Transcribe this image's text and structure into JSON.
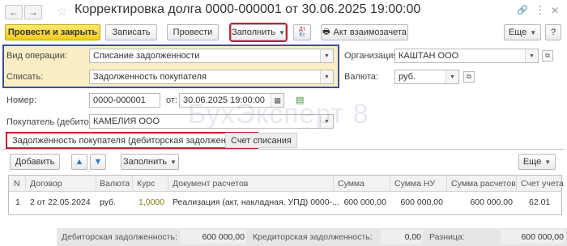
{
  "window": {
    "title": "Корректировка долга 0000-000001 от 30.06.2025 19:00:00",
    "back_glyph": "←",
    "forward_glyph": "→",
    "star_glyph": "☆",
    "link_glyph": "🔗",
    "more_glyph": "⋮",
    "close_glyph": "✕"
  },
  "toolbar": {
    "post_close": "Провести и закрыть",
    "save": "Записать",
    "post": "Провести",
    "fill": "Заполнить",
    "dtkt_top": "Дт",
    "dtkt_bottom": "Кт",
    "settlement_act": "Акт взаимозачета",
    "more": "Еще",
    "help": "?"
  },
  "form": {
    "operation_label": "Вид операции:",
    "operation_value": "Списание задолженности",
    "writeoff_label": "Списать:",
    "writeoff_value": "Задолженность покупателя",
    "org_label": "Организация:",
    "org_value": "КАШТАН ООО",
    "currency_label": "Валюта:",
    "currency_value": "руб.",
    "number_label": "Номер:",
    "number_value": "0000-000001",
    "date_label": "от:",
    "date_value": "30.06.2025 19:00:00",
    "buyer_label": "Покупатель (дебитор):",
    "buyer_value": "КАМЕЛИЯ ООО"
  },
  "watermark": "БухЭксперт 8",
  "tabs": [
    {
      "label": "Задолженность покупателя (дебиторская задолженность)"
    },
    {
      "label": "Счет списания"
    }
  ],
  "table_toolbar": {
    "add": "Добавить",
    "fill": "Заполнить",
    "more": "Еще"
  },
  "table": {
    "columns": [
      "N",
      "Договор",
      "Валюта",
      "Курс",
      "Документ расчетов",
      "Сумма",
      "Сумма НУ",
      "Сумма расчетов",
      "Счет учета"
    ],
    "rows": [
      {
        "n": "1",
        "contract": "2 от 22.05.2024",
        "currency": "руб.",
        "rate": "1,0000",
        "doc": "Реализация (акт, накладная, УПД) 0000-...",
        "amount": "600 000,00",
        "amount_nu": "600 000,00",
        "amount_settle": "600 000,00",
        "account": "62.01"
      }
    ]
  },
  "footer": {
    "debit_label": "Дебиторская задолженность:",
    "debit_value": "600 000,00",
    "credit_label": "Кредиторская задолженность:",
    "credit_value": "0,00",
    "diff_label": "Разница:",
    "diff_value": "600 000,00"
  },
  "colors": {
    "primary_button": "#f5cc1c",
    "highlight_block": "#fbeec4",
    "block_border": "#3a4e9b",
    "red_frame": "#c8202d"
  }
}
